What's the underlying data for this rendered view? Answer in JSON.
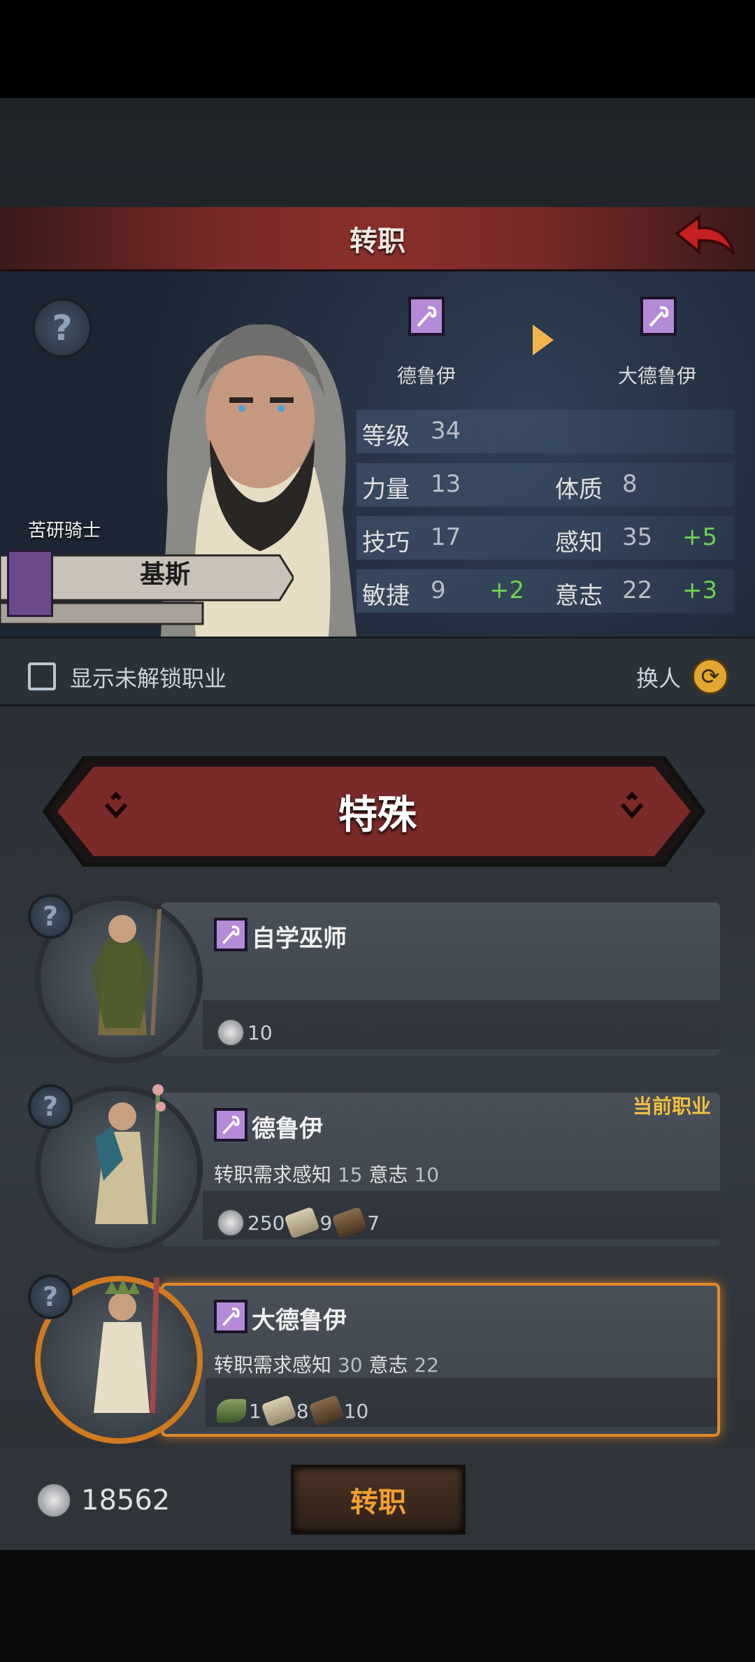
{
  "header": {
    "title": "转职"
  },
  "character": {
    "title": "苦研骑士",
    "name": "基斯",
    "from_class": "德鲁伊",
    "to_class": "大德鲁伊",
    "stats": {
      "level_label": "等级",
      "level": "34",
      "str_label": "力量",
      "str": "13",
      "con_label": "体质",
      "con": "8",
      "skill_label": "技巧",
      "skill": "17",
      "per_label": "感知",
      "per": "35",
      "per_bonus": "+5",
      "agi_label": "敏捷",
      "agi": "9",
      "agi_bonus": "+2",
      "will_label": "意志",
      "will": "22",
      "will_bonus": "+3"
    }
  },
  "filter": {
    "show_locked_label": "显示未解锁职业",
    "swap_label": "换人"
  },
  "category": {
    "title": "特殊"
  },
  "classes": [
    {
      "name": "自学巫师",
      "cost_silver": "10"
    },
    {
      "name": "德鲁伊",
      "current_tag": "当前职业",
      "req_label": "转职需求",
      "req_a_label": "感知",
      "req_a": "15",
      "req_b_label": "意志",
      "req_b": "10",
      "cost_silver": "250",
      "cost_scroll": "9",
      "cost_wood": "7"
    },
    {
      "name": "大德鲁伊",
      "req_label": "转职需求",
      "req_a_label": "感知",
      "req_a": "30",
      "req_b_label": "意志",
      "req_b": "22",
      "cost_leaf": "1",
      "cost_scroll": "8",
      "cost_log": "10"
    }
  ],
  "bottom": {
    "silver": "18562",
    "confirm_label": "转职"
  },
  "icons": [
    "question-icon",
    "back-arrow-icon",
    "staff-icon",
    "swap-icon",
    "silver-coin-icon",
    "scroll-icon",
    "wood-icon",
    "leaf-icon",
    "log-icon"
  ],
  "colors": {
    "accent_red": "#8a2f2c",
    "bonus_green": "#6fd14f",
    "class_purple": "#b58ad8",
    "confirm_orange": "#f0a030"
  }
}
